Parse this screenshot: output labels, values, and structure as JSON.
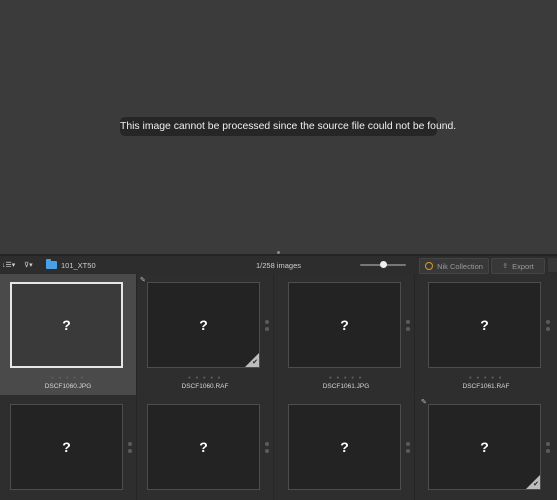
{
  "viewer": {
    "message": "This image cannot be processed since the source file could not be found."
  },
  "toolbar": {
    "sort_icon": "↓☰▾",
    "filter_icon": "⊽▾",
    "folder_name": "101_XT50",
    "image_count": "1/258 images",
    "nik_label": "Nik Collection",
    "export_label": "Export",
    "zoom_level": 0.5
  },
  "thumbnails": [
    {
      "filename": "DSCF1060.JPG",
      "placeholder": "?",
      "selected": true
    },
    {
      "filename": "DSCF1060.RAF",
      "placeholder": "?",
      "selected": false,
      "edited_badge": true,
      "checked": true
    },
    {
      "filename": "DSCF1061.JPG",
      "placeholder": "?",
      "selected": false
    },
    {
      "filename": "DSCF1061.RAF",
      "placeholder": "?",
      "selected": false
    },
    {
      "filename": "",
      "placeholder": "?",
      "selected": false
    },
    {
      "filename": "",
      "placeholder": "?",
      "selected": false
    },
    {
      "filename": "",
      "placeholder": "?",
      "selected": false
    },
    {
      "filename": "",
      "placeholder": "?",
      "selected": false,
      "edited_badge": true,
      "checked": true
    }
  ],
  "colors": {
    "viewer_bg": "#3b3b3b",
    "folder_icon": "#4a9fe6",
    "selected_border": "#e6e6e6"
  }
}
